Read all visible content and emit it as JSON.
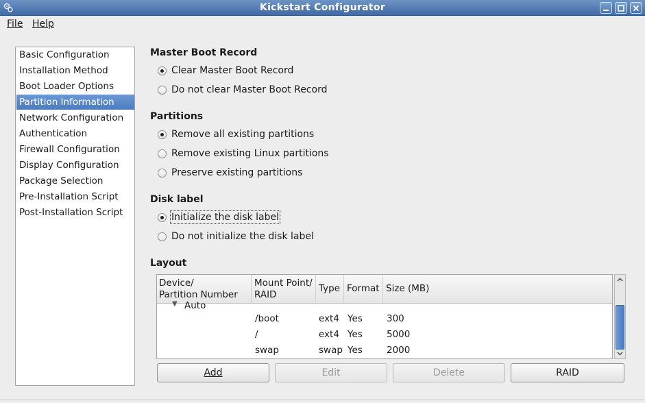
{
  "window": {
    "title": "Kickstart Configurator"
  },
  "menu": {
    "file": "File",
    "help": "Help"
  },
  "sidebar": {
    "items": [
      {
        "label": "Basic Configuration",
        "selected": false
      },
      {
        "label": "Installation Method",
        "selected": false
      },
      {
        "label": "Boot Loader Options",
        "selected": false
      },
      {
        "label": "Partition Information",
        "selected": true
      },
      {
        "label": "Network Configuration",
        "selected": false
      },
      {
        "label": "Authentication",
        "selected": false
      },
      {
        "label": "Firewall Configuration",
        "selected": false
      },
      {
        "label": "Display Configuration",
        "selected": false
      },
      {
        "label": "Package Selection",
        "selected": false
      },
      {
        "label": "Pre-Installation Script",
        "selected": false
      },
      {
        "label": "Post-Installation Script",
        "selected": false
      }
    ]
  },
  "mbr": {
    "title": "Master Boot Record",
    "options": [
      {
        "label": "Clear Master Boot Record",
        "checked": true
      },
      {
        "label": "Do not clear Master Boot Record",
        "checked": false
      }
    ]
  },
  "partitions": {
    "title": "Partitions",
    "options": [
      {
        "label": "Remove all existing partitions",
        "checked": true
      },
      {
        "label": "Remove existing Linux partitions",
        "checked": false
      },
      {
        "label": "Preserve existing partitions",
        "checked": false
      }
    ]
  },
  "disklabel": {
    "title": "Disk label",
    "options": [
      {
        "label": "Initialize the disk label",
        "checked": true
      },
      {
        "label": "Do not initialize the disk label",
        "checked": false
      }
    ]
  },
  "layout": {
    "title": "Layout",
    "columns": {
      "device_line1": "Device/",
      "device_line2": "Partition Number",
      "mount_line1": "Mount Point/",
      "mount_line2": "RAID",
      "type": "Type",
      "format": "Format",
      "size": "Size (MB)"
    },
    "group_label": "Auto",
    "rows": [
      {
        "mount": "/boot",
        "type": "ext4",
        "format": "Yes",
        "size": "300"
      },
      {
        "mount": "/",
        "type": "ext4",
        "format": "Yes",
        "size": "5000"
      },
      {
        "mount": "swap",
        "type": "swap",
        "format": "Yes",
        "size": "2000"
      }
    ]
  },
  "buttons": {
    "add": "Add",
    "edit": "Edit",
    "delete": "Delete",
    "raid": "RAID"
  }
}
